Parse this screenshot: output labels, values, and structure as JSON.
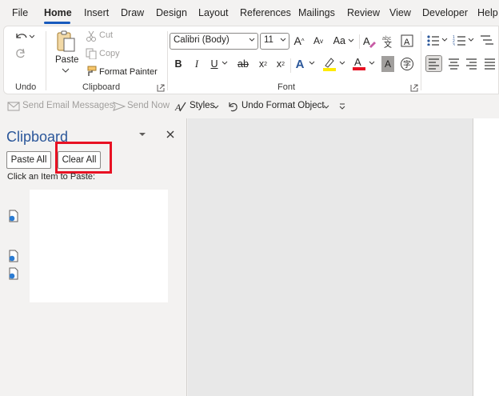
{
  "menu": {
    "items": [
      {
        "label": "File",
        "active": false
      },
      {
        "label": "Home",
        "active": true
      },
      {
        "label": "Insert",
        "active": false
      },
      {
        "label": "Draw",
        "active": false
      },
      {
        "label": "Design",
        "active": false
      },
      {
        "label": "Layout",
        "active": false
      },
      {
        "label": "References",
        "active": false
      },
      {
        "label": "Mailings",
        "active": false
      },
      {
        "label": "Review",
        "active": false
      },
      {
        "label": "View",
        "active": false
      },
      {
        "label": "Developer",
        "active": false
      },
      {
        "label": "Help",
        "active": false
      }
    ]
  },
  "ribbon": {
    "undo_group": {
      "label": "Undo"
    },
    "clipboard_group": {
      "label": "Clipboard",
      "paste": "Paste",
      "cut": "Cut",
      "copy": "Copy",
      "format_painter": "Format Painter"
    },
    "font_group": {
      "label": "Font",
      "font_name": "Calibri (Body)",
      "font_size": "11",
      "bold": "B",
      "italic": "I",
      "underline": "U",
      "strikethrough": "ab",
      "subscript": "x",
      "superscript": "x",
      "sub_mark": "2",
      "super_mark": "2",
      "grow": "A",
      "shrink": "A",
      "change_case": "Aa",
      "text_effects": "A",
      "font_color": "A",
      "shading": "A"
    },
    "colors": {
      "accent": "#185abd",
      "highlight": "#ffeb00",
      "font_color": "#e81123",
      "pane_title": "#2b579a"
    }
  },
  "qat": {
    "send_email": "Send Email Messages",
    "send_now": "Send Now",
    "styles": "Styles",
    "undo_format": "Undo Format Object"
  },
  "clipboard_pane": {
    "title": "Clipboard",
    "paste_all": "Paste All",
    "clear_all": "Clear All",
    "hint": "Click an Item to Paste:",
    "items": [
      {
        "icon": "clipboard-item-icon"
      },
      {
        "icon": "clipboard-item-icon"
      },
      {
        "icon": "clipboard-item-icon"
      }
    ]
  }
}
